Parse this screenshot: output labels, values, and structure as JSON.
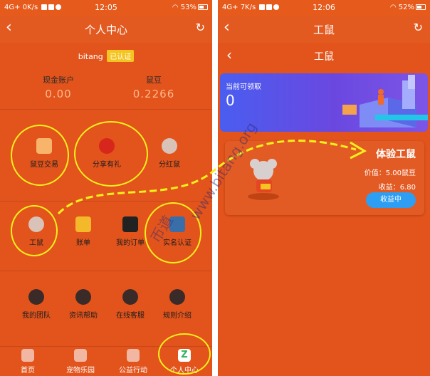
{
  "left": {
    "status": {
      "carrier": "4G+",
      "net": "0K/s",
      "time": "12:05",
      "battery": "53%"
    },
    "nav": {
      "title": "个人中心"
    },
    "user": {
      "name": "bitang",
      "badge": "已认证"
    },
    "accounts": [
      {
        "label": "现金账户",
        "value": "0.00"
      },
      {
        "label": "鼠豆",
        "value": "0.2266"
      }
    ],
    "grid_row1": [
      {
        "label": "鼠豆交易",
        "icon": "handshake-icon",
        "color": "#f7b46a"
      },
      {
        "label": "分享有礼",
        "icon": "gift-icon",
        "color": "#d7261b"
      },
      {
        "label": "分红鼠",
        "icon": "mouse-icon",
        "color": "#d9c2b8"
      }
    ],
    "grid_row2": [
      {
        "label": "工鼠",
        "icon": "worker-mouse-icon",
        "color": "#d9c2b8"
      },
      {
        "label": "账单",
        "icon": "bill-icon",
        "color": "#f4b92a"
      },
      {
        "label": "我的订单",
        "icon": "order-icon",
        "color": "#222222"
      },
      {
        "label": "实名认证",
        "icon": "id-card-icon",
        "color": "#3a6ea8"
      }
    ],
    "grid_row3": [
      {
        "label": "我的团队",
        "icon": "team-icon",
        "color": "#3b2b28"
      },
      {
        "label": "资讯帮助",
        "icon": "help-icon",
        "color": "#3b2b28"
      },
      {
        "label": "在线客服",
        "icon": "service-icon",
        "color": "#3b2b28"
      },
      {
        "label": "规则介绍",
        "icon": "rules-icon",
        "color": "#3b2b28"
      }
    ],
    "tabs": [
      {
        "label": "首页",
        "icon": "home-icon"
      },
      {
        "label": "宠物乐园",
        "icon": "pet-icon"
      },
      {
        "label": "公益行动",
        "icon": "charity-icon"
      },
      {
        "label": "个人中心",
        "icon": "profile-icon",
        "active_glyph": "Z"
      }
    ]
  },
  "right": {
    "status": {
      "carrier": "4G+",
      "net": "7K/s",
      "time": "12:06",
      "battery": "52%"
    },
    "nav": {
      "title": "工鼠"
    },
    "subnav": {
      "title": "工鼠"
    },
    "banner": {
      "label": "当前可领取",
      "amount": "0"
    },
    "card": {
      "name": "体验工鼠",
      "price": "价值：5.00鼠豆",
      "earn": "收益：6.80",
      "button": "收益中"
    }
  },
  "watermark": {
    "cn": "币道",
    "url": "www.bitang.org"
  },
  "colors": {
    "accent": "#e2541c",
    "highlight": "#f7f01c",
    "button": "#2d9ef2",
    "banner": "#4a5df0"
  }
}
